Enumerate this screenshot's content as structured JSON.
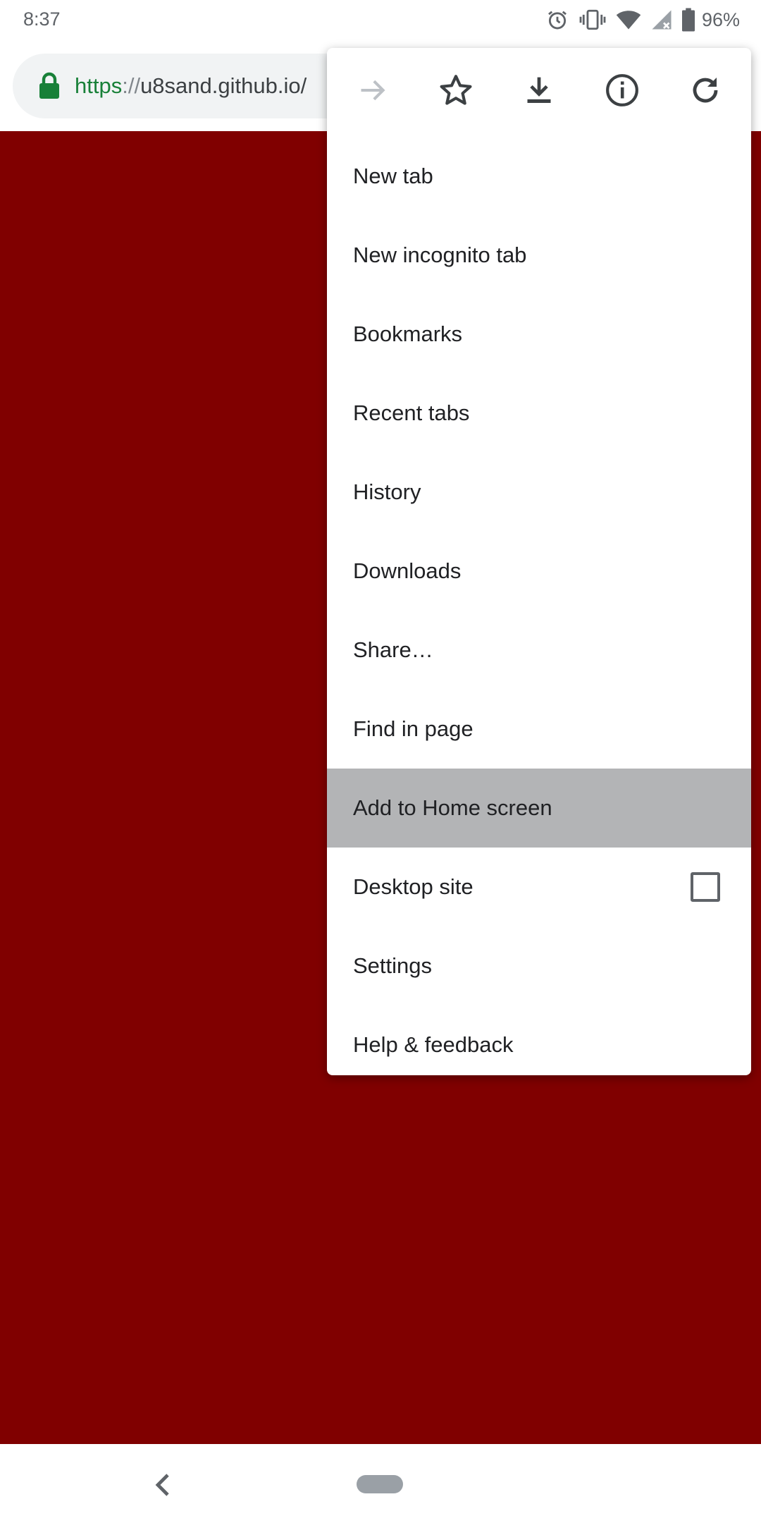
{
  "status_bar": {
    "time": "8:37",
    "battery": "96%",
    "icons": [
      "alarm-icon",
      "vibrate-icon",
      "wifi-icon",
      "cell-signal-icon",
      "battery-icon"
    ]
  },
  "omnibox": {
    "url_scheme": "https",
    "url_separator": "://",
    "url_host": "u8sand.github.io/",
    "lock_color": "#188038"
  },
  "page": {
    "background": "#800000"
  },
  "menu": {
    "icons": [
      "forward-icon",
      "bookmark-star-icon",
      "download-icon",
      "info-icon",
      "reload-icon"
    ],
    "items": [
      {
        "label": "New tab"
      },
      {
        "label": "New incognito tab"
      },
      {
        "label": "Bookmarks"
      },
      {
        "label": "Recent tabs"
      },
      {
        "label": "History"
      },
      {
        "label": "Downloads"
      },
      {
        "label": "Share…"
      },
      {
        "label": "Find in page"
      },
      {
        "label": "Add to Home screen",
        "highlighted": true
      },
      {
        "label": "Desktop site",
        "checkbox": false
      },
      {
        "label": "Settings"
      },
      {
        "label": "Help & feedback"
      }
    ]
  }
}
